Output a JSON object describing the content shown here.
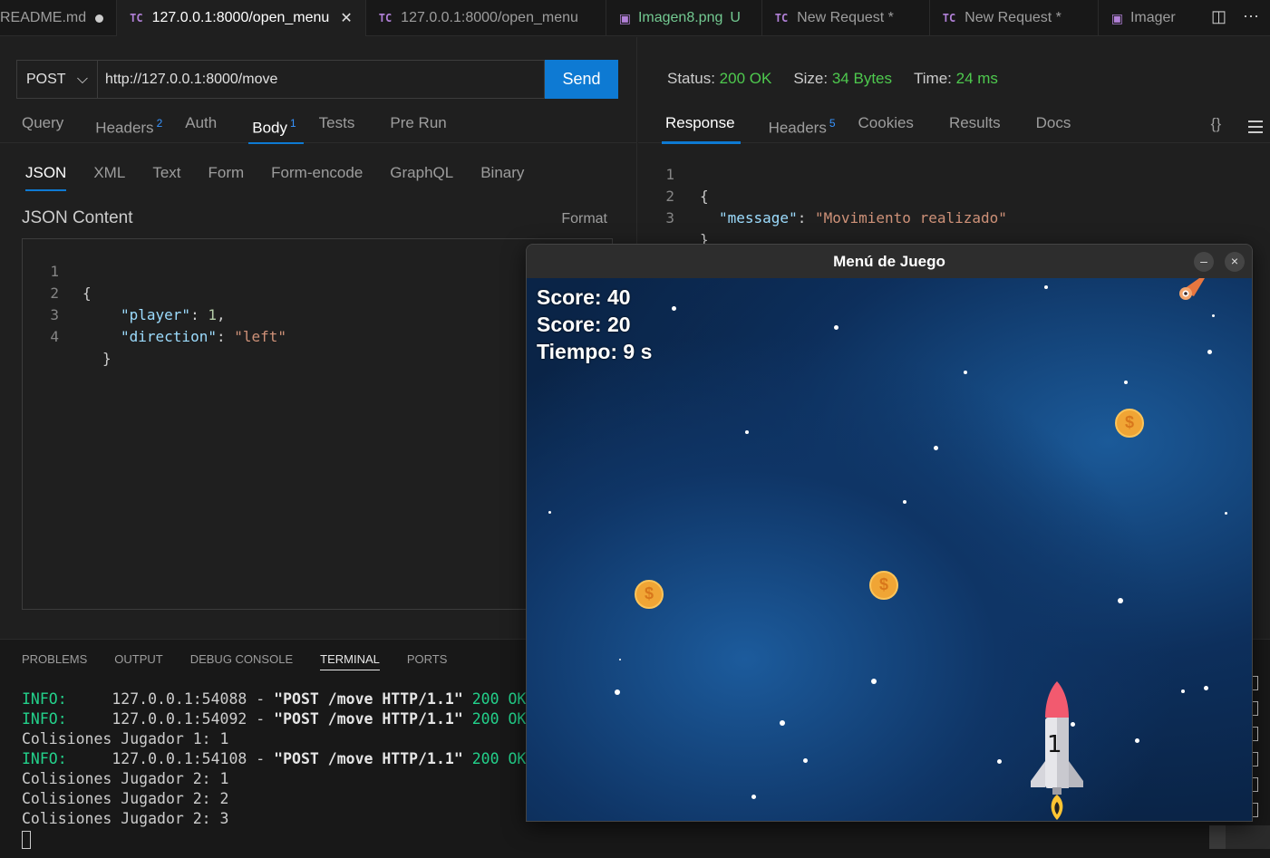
{
  "tabs": [
    {
      "label": "README.md",
      "kind": "md",
      "dirty": true
    },
    {
      "label": "127.0.0.1:8000/open_menu",
      "kind": "tc",
      "active": true
    },
    {
      "label": "127.0.0.1:8000/open_menu",
      "kind": "tc"
    },
    {
      "label": "Imagen8.png",
      "kind": "img",
      "git": "U"
    },
    {
      "label": "New Request *",
      "kind": "tc"
    },
    {
      "label": "New Request *",
      "kind": "tc"
    },
    {
      "label": "Imager",
      "kind": "img"
    }
  ],
  "tc_badge": "TC",
  "request": {
    "method": "POST",
    "url": "http://127.0.0.1:8000/move",
    "send_label": "Send",
    "tabs": [
      {
        "label": "Query"
      },
      {
        "label": "Headers",
        "count": "2"
      },
      {
        "label": "Auth"
      },
      {
        "label": "Body",
        "count": "1",
        "active": true
      },
      {
        "label": "Tests"
      },
      {
        "label": "Pre Run"
      }
    ],
    "body_types": [
      "JSON",
      "XML",
      "Text",
      "Form",
      "Form-encode",
      "GraphQL",
      "Binary"
    ],
    "json_content_label": "JSON Content",
    "format_label": "Format",
    "editor_lines": [
      {
        "num": "1",
        "text": "{"
      },
      {
        "num": "2",
        "key": "\"player\"",
        "sep": ": ",
        "val": "1",
        "tail": ","
      },
      {
        "num": "3",
        "key": "\"direction\"",
        "sep": ": ",
        "sval": "\"left\""
      },
      {
        "num": "4",
        "text": "}"
      }
    ]
  },
  "response": {
    "status_label": "Status:",
    "status_value": "200 OK",
    "size_label": "Size:",
    "size_value": "34 Bytes",
    "time_label": "Time:",
    "time_value": "24 ms",
    "tabs": [
      {
        "label": "Response",
        "active": true
      },
      {
        "label": "Headers",
        "count": "5"
      },
      {
        "label": "Cookies"
      },
      {
        "label": "Results"
      },
      {
        "label": "Docs"
      }
    ],
    "braces_label": "{}",
    "lines": [
      {
        "num": "1",
        "text": "{"
      },
      {
        "num": "2",
        "key": "\"message\"",
        "sep": ": ",
        "sval": "\"Movimiento realizado\""
      },
      {
        "num": "3",
        "text": "}"
      }
    ]
  },
  "panel": {
    "tabs": [
      "PROBLEMS",
      "OUTPUT",
      "DEBUG CONSOLE",
      "TERMINAL",
      "PORTS"
    ],
    "active": "TERMINAL",
    "terminal": [
      {
        "type": "info",
        "prefix": "INFO:",
        "addr": "127.0.0.1:54088",
        "req": "\"POST /move HTTP/1.1\"",
        "code": "200 OK"
      },
      {
        "type": "info",
        "prefix": "INFO:",
        "addr": "127.0.0.1:54092",
        "req": "\"POST /move HTTP/1.1\"",
        "code": "200 OK"
      },
      {
        "type": "plain",
        "text": "Colisiones Jugador 1: 1"
      },
      {
        "type": "info",
        "prefix": "INFO:",
        "addr": "127.0.0.1:54108",
        "req": "\"POST /move HTTP/1.1\"",
        "code": "200 OK"
      },
      {
        "type": "plain",
        "text": "Colisiones Jugador 2: 1"
      },
      {
        "type": "plain",
        "text": "Colisiones Jugador 2: 2"
      },
      {
        "type": "plain",
        "text": "Colisiones Jugador 2: 3"
      }
    ]
  },
  "game": {
    "title": "Menú de Juego",
    "minimize": "–",
    "close": "×",
    "hud": [
      "Score: 40",
      "Score: 20",
      "Tiempo: 9 s"
    ],
    "coin_symbol": "$",
    "rocket_label": "1"
  },
  "colors": {
    "accent": "#0e7ad3",
    "success": "#4ec94e",
    "terminal_info": "#23d18b",
    "tc_badge": "#b180d7"
  }
}
